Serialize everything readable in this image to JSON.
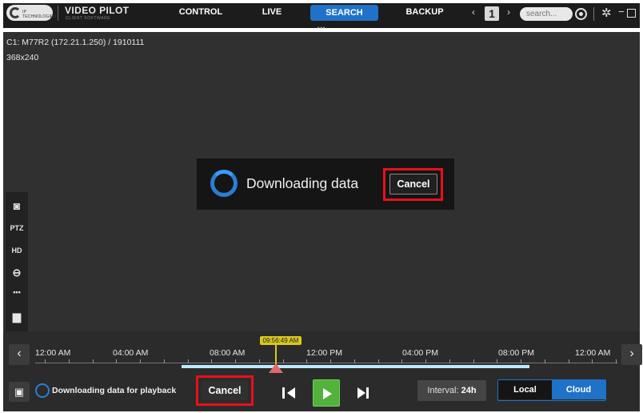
{
  "app": {
    "logo_text": "IP TECHNOLOGIES",
    "title": "VIDEO PILOT",
    "subtitle": "CLIENT SOFTWARE"
  },
  "nav": {
    "tabs": [
      {
        "label": "CONTROL",
        "active": false
      },
      {
        "label": "LIVE",
        "active": false
      },
      {
        "label": "SEARCH",
        "active": true
      },
      {
        "label": "BACKUP",
        "active": false
      }
    ],
    "prev_glyph": "‹",
    "page_number": "1",
    "next_glyph": "›",
    "search_placeholder": "search..."
  },
  "window_controls": {
    "settings_icon": "gear-icon",
    "minimize_glyph": "−",
    "maximize_icon": "maximize-icon"
  },
  "video": {
    "camera_info": "C1: M77R2 (172.21.1.250) / 1910111",
    "resolution": "368x240",
    "toolbar": [
      {
        "name": "snapshot-icon",
        "glyph": "◙"
      },
      {
        "name": "ptz-button",
        "label": "PTZ"
      },
      {
        "name": "hd-button",
        "label": "HD"
      },
      {
        "name": "link-icon",
        "glyph": "⊖"
      },
      {
        "name": "more-icon",
        "glyph": "•••"
      },
      {
        "name": "print-icon",
        "glyph": "▆"
      }
    ]
  },
  "dialog": {
    "message": "Downloading data",
    "cancel_label": "Cancel"
  },
  "timeline": {
    "tick_labels": [
      "12:00 AM",
      "04:00 AM",
      "08:00 AM",
      "12:00 PM",
      "04:00 PM",
      "08:00 PM",
      "12:00 AM"
    ],
    "cursor_time": "09:56:49 AM",
    "prev_glyph": "‹",
    "next_glyph": "›"
  },
  "bottom_bar": {
    "calendar_glyph": "▣",
    "status_text": "Downloading data for playback",
    "cancel_label": "Cancel",
    "interval_label": "Interval:",
    "interval_value": "24h",
    "source_local": "Local",
    "source_cloud": "Cloud",
    "active_source": "Cloud"
  },
  "colors": {
    "accent": "#1f72c7",
    "highlight_red": "#e8101b",
    "play_green": "#52b23c",
    "cursor_yellow": "#d9c820",
    "coverage": "#bde8ff"
  }
}
